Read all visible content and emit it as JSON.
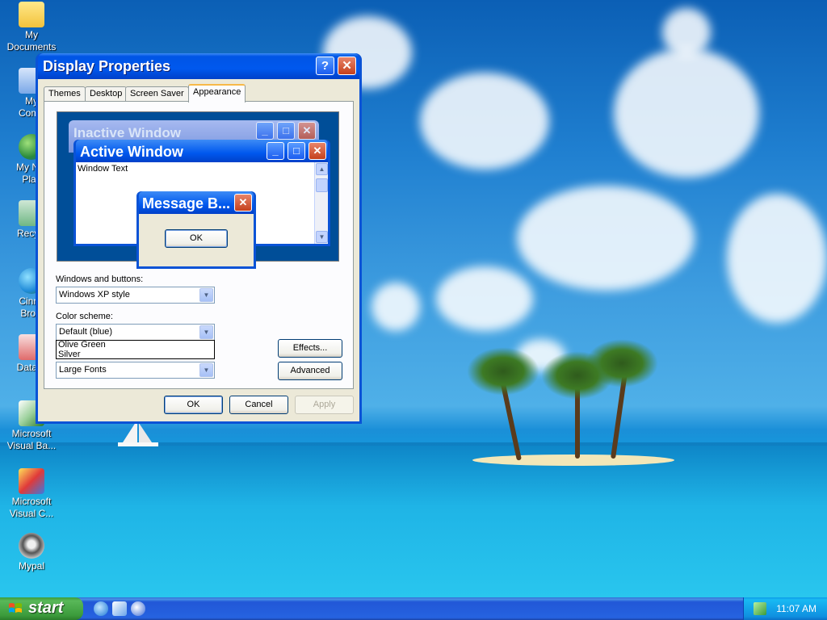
{
  "desktop": {
    "icons": [
      {
        "name": "my-documents",
        "line1": "My",
        "line2": "Documents"
      },
      {
        "name": "my-computer",
        "line1": "My",
        "line2": "Comp"
      },
      {
        "name": "my-network-places",
        "line1": "My Net",
        "line2": "Plac"
      },
      {
        "name": "recycle-bin",
        "line1": "Recycl",
        "line2": ""
      },
      {
        "name": "cinnamon-browser",
        "line1": "Cinna",
        "line2": "Brow"
      },
      {
        "name": "datawindow",
        "line1": "DataW",
        "line2": ""
      },
      {
        "name": "microsoft-visual-basic",
        "line1": "Microsoft",
        "line2": "Visual Ba..."
      },
      {
        "name": "microsoft-visual-c",
        "line1": "Microsoft",
        "line2": "Visual C..."
      },
      {
        "name": "mypal",
        "line1": "Mypal",
        "line2": ""
      }
    ]
  },
  "window": {
    "title": "Display Properties",
    "help_glyph": "?",
    "close_glyph": "✕",
    "tabs": [
      "Themes",
      "Desktop",
      "Screen Saver",
      "Appearance"
    ],
    "active_tab": "Appearance",
    "preview": {
      "inactive_title": "Inactive Window",
      "active_title": "Active Window",
      "window_text": "Window Text",
      "message_title": "Message B...",
      "message_ok": "OK"
    },
    "windows_buttons_label": "Windows and buttons:",
    "windows_buttons_value": "Windows XP style",
    "color_scheme_label": "Color scheme:",
    "color_scheme_value": "Default (blue)",
    "color_scheme_options_visible": [
      "Olive Green",
      "Silver"
    ],
    "font_size_value": "Large Fonts",
    "effects_button": "Effects...",
    "advanced_button": "Advanced",
    "ok_button": "OK",
    "cancel_button": "Cancel",
    "apply_button": "Apply"
  },
  "taskbar": {
    "start_label": "start",
    "clock": "11:07 AM"
  },
  "colors": {
    "titlebar_blue": "#0058ee",
    "start_green": "#3b9b3b",
    "dialog_face": "#ece9d8"
  }
}
